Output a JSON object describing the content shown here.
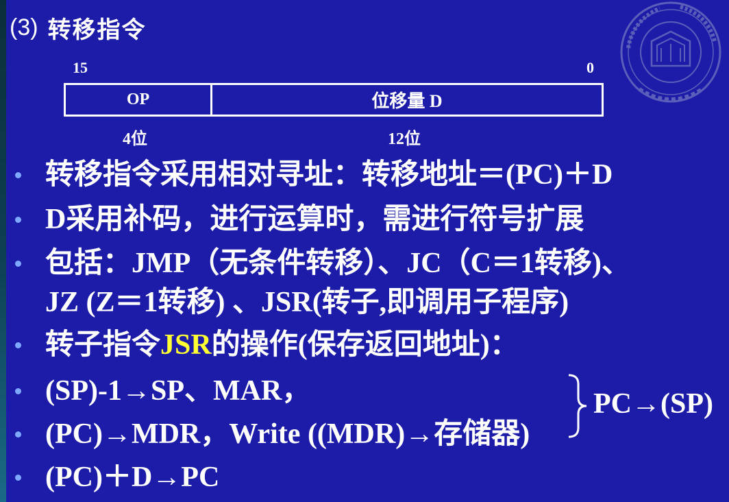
{
  "slide": {
    "section_number": "(3)",
    "title": "转移指令"
  },
  "format": {
    "high_bit": "15",
    "low_bit": "0",
    "fields": [
      {
        "name": "OP",
        "width_label": "4位"
      },
      {
        "name": "位移量 D",
        "width_label": "12位"
      }
    ]
  },
  "bullets": [
    {
      "text": "转移指令采用相对寻址：转移地址＝(PC)＋D"
    },
    {
      "text": "D采用补码，进行运算时，需进行符号扩展"
    },
    {
      "text": "包括：JMP（无条件转移）、JC（C＝1转移)、",
      "continuation": "JZ (Z＝1转移) 、JSR(转子,即调用子程序)"
    },
    {
      "prefix": "转子指令",
      "highlight": "JSR",
      "suffix": "的操作(保存返回地址)："
    },
    {
      "text": "(SP)-1→SP、MAR，"
    },
    {
      "text": "(PC)→MDR，Write ((MDR)→存储器)"
    },
    {
      "text": "(PC)＋D→PC"
    }
  ],
  "brace_result": "PC→(SP)",
  "colors": {
    "background": "#1c1ca8",
    "text": "#ffffff",
    "highlight": "#ffff33",
    "bullet": "#7fa8ff"
  }
}
